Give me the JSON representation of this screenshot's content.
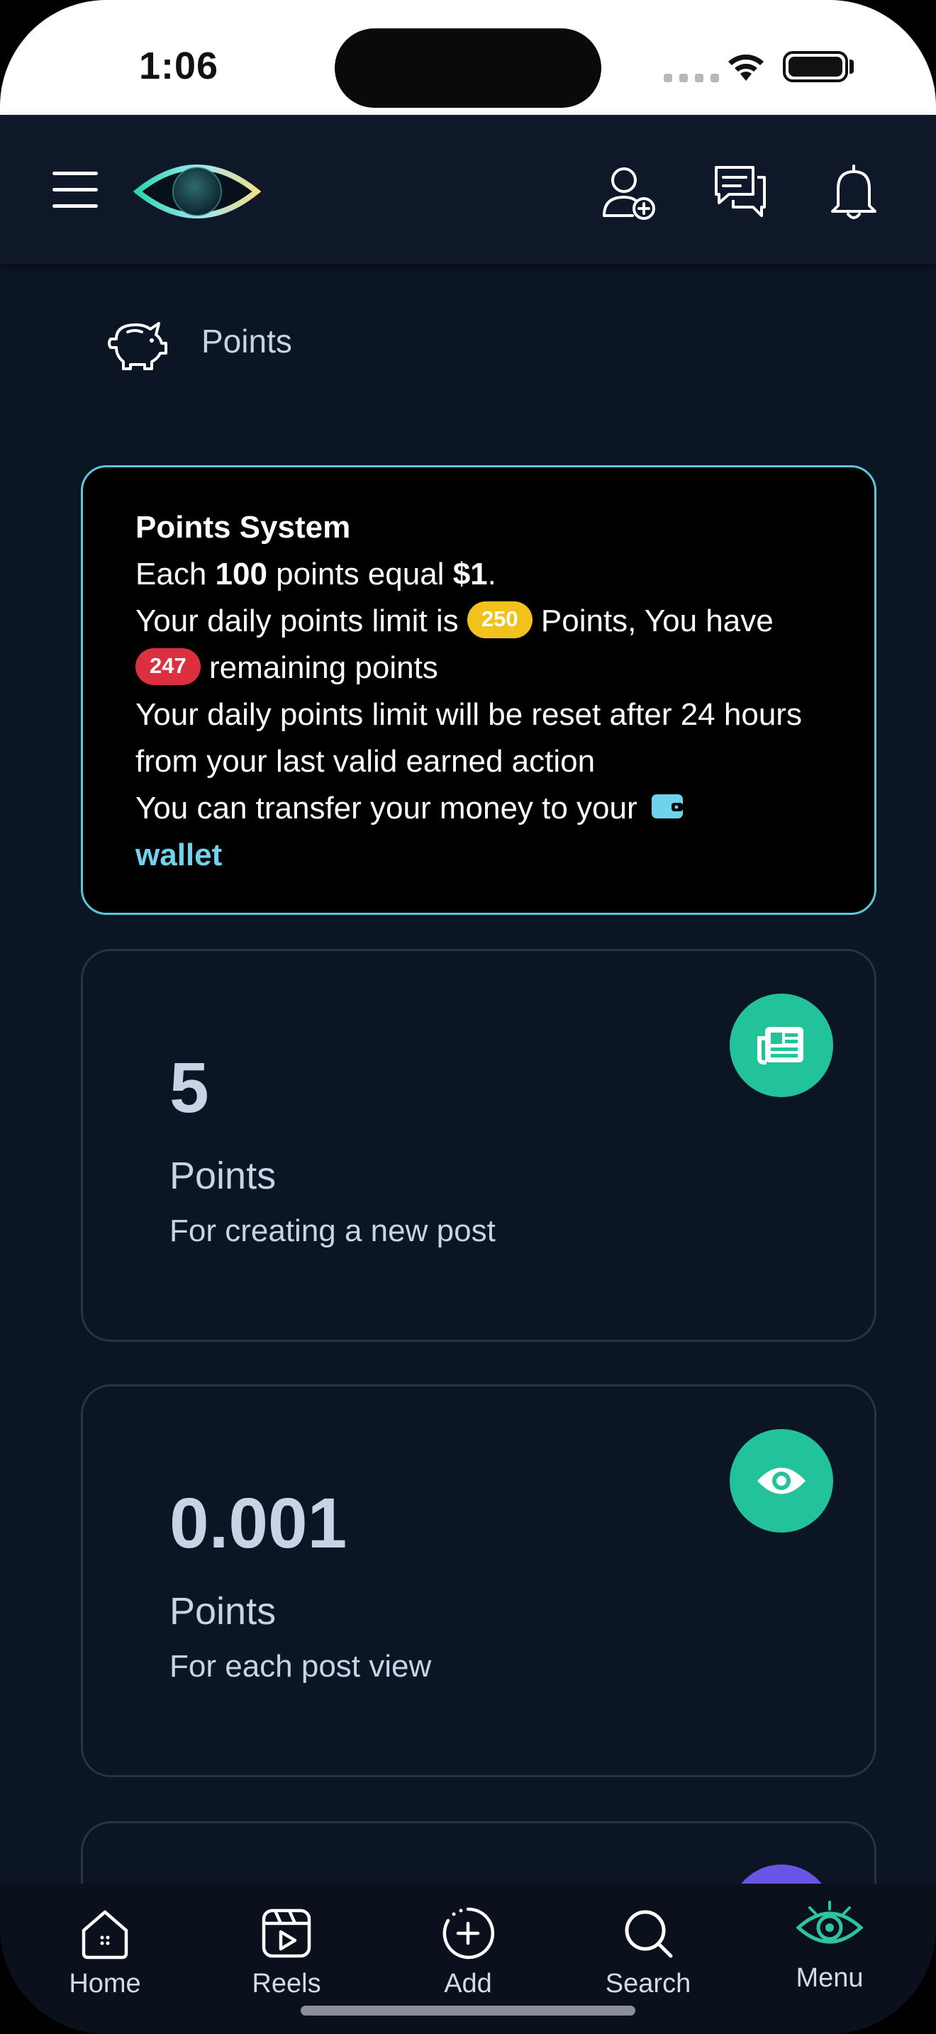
{
  "status_bar": {
    "time": "1:06"
  },
  "breadcrumb": {
    "label": "Points"
  },
  "info_card": {
    "title": "Points System",
    "line1_prefix": "Each ",
    "line1_points": "100",
    "line1_mid": " points equal ",
    "line1_value": "$1",
    "line1_suffix": ".",
    "limit_prefix": "Your daily points limit is ",
    "limit_value": "250",
    "limit_suffix": " Points, You have ",
    "remaining_value": "247",
    "remaining_suffix": " remaining points",
    "reset_text": "Your daily points limit will be reset after 24 hours from your last valid earned action",
    "transfer_text": "You can transfer your money to your ",
    "wallet_link": "wallet"
  },
  "stats": [
    {
      "value": "5",
      "unit": "Points",
      "description": "For creating a new post",
      "icon": "newspaper-icon"
    },
    {
      "value": "0.001",
      "unit": "Points",
      "description": "For each post view",
      "icon": "eye-icon"
    }
  ],
  "bottom_nav": {
    "items": [
      {
        "label": "Home",
        "icon": "home-icon"
      },
      {
        "label": "Reels",
        "icon": "reels-icon"
      },
      {
        "label": "Add",
        "icon": "add-icon"
      },
      {
        "label": "Search",
        "icon": "search-icon"
      },
      {
        "label": "Menu",
        "icon": "eye-logo-icon"
      }
    ]
  },
  "colors": {
    "background": "#0c1524",
    "accent_teal": "#22c29a",
    "info_border": "#5ac8dc",
    "badge_yellow": "#f2c11c",
    "badge_red": "#dc3040",
    "link": "#6fd3ee"
  }
}
